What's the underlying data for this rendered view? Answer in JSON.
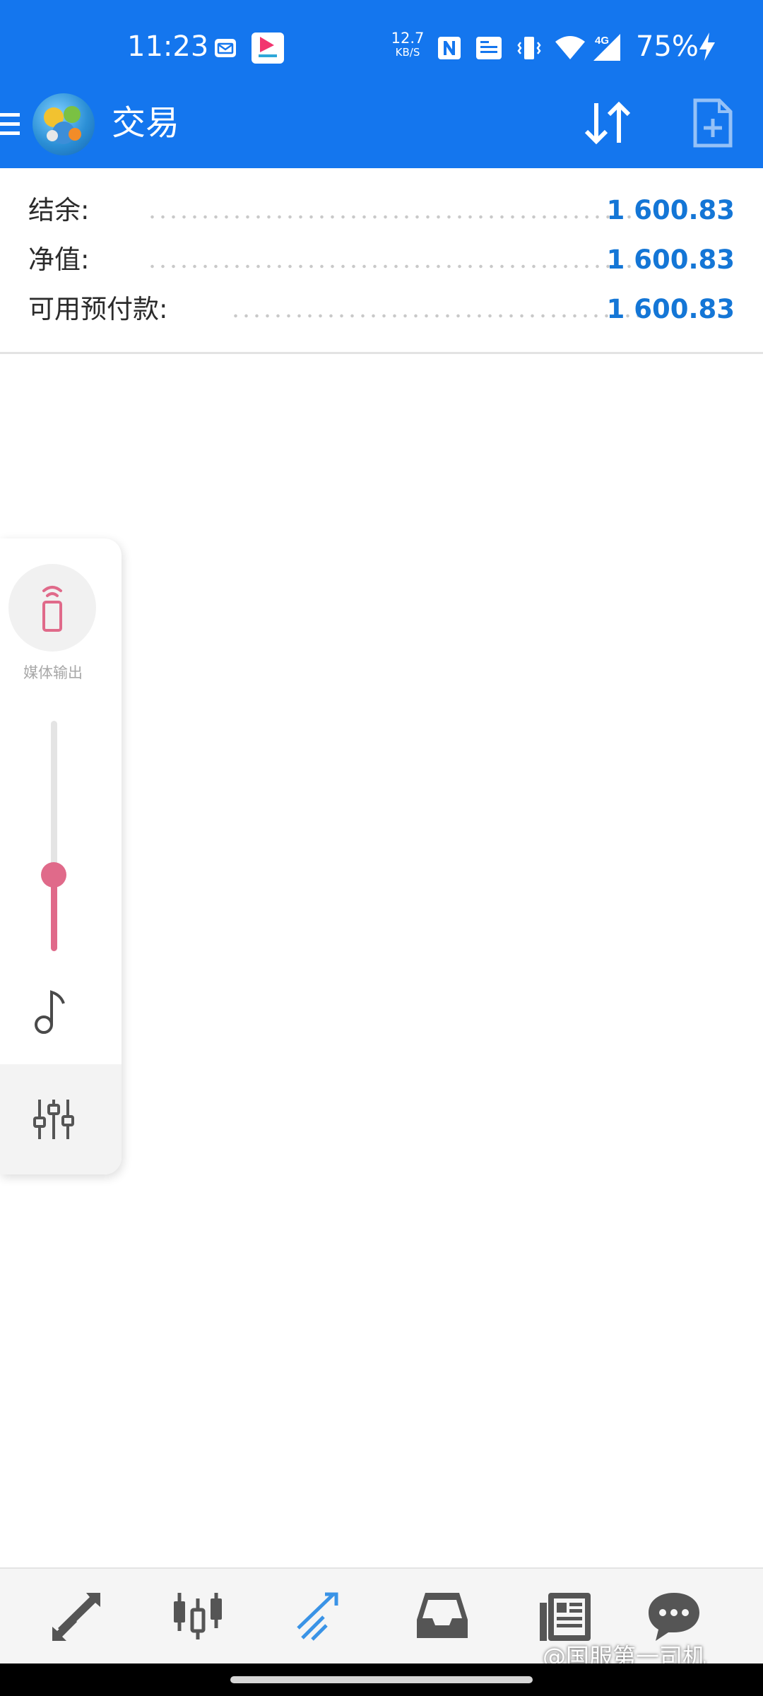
{
  "status_bar": {
    "time": "11:23",
    "net_speed_value": "12.7",
    "net_speed_unit": "KB/S",
    "battery_percent": "75%",
    "icons": [
      "mail-icon",
      "app-notification-icon",
      "nfc-icon",
      "volte-icon",
      "vibrate-icon",
      "wifi-icon",
      "signal-4g-icon",
      "charging-icon"
    ]
  },
  "app_bar": {
    "title": "交易",
    "color": "#1476ee",
    "icons": [
      "menu-icon",
      "app-logo",
      "sort-icon",
      "new-order-icon"
    ]
  },
  "account": {
    "rows": [
      {
        "label": "结余:",
        "value": "1 600.83"
      },
      {
        "label": "净值:",
        "value": "1 600.83"
      },
      {
        "label": "可用预付款:",
        "value": "1 600.83"
      }
    ],
    "value_color": "#1476d6"
  },
  "volume_panel": {
    "media_output_label": "媒体输出",
    "volume_level": 0.33,
    "accent_color": "#e06a8a",
    "icons": [
      "cast-icon",
      "music-note-icon",
      "equalizer-icon"
    ]
  },
  "bottom_nav": {
    "items": [
      "quotes-icon",
      "chart-icon",
      "trade-icon",
      "history-icon",
      "news-icon",
      "messages-icon"
    ],
    "active_index": 2,
    "active_color": "#3a93e6",
    "inactive_color": "#555555"
  },
  "watermark": "@国服第一司机"
}
